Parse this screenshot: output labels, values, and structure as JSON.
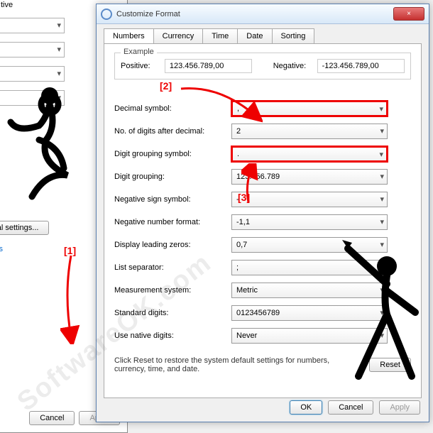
{
  "bg": {
    "tive_label": "tive",
    "additional": "Additional settings...",
    "link": "ional formats",
    "cancel": "Cancel",
    "apply": "Apply"
  },
  "dialog": {
    "title": "Customize Format",
    "close": "×",
    "tabs": [
      "Numbers",
      "Currency",
      "Time",
      "Date",
      "Sorting"
    ],
    "example": {
      "legend": "Example",
      "pos_label": "Positive:",
      "pos_value": "123.456.789,00",
      "neg_label": "Negative:",
      "neg_value": "-123.456.789,00"
    },
    "rows": [
      {
        "label": "Decimal symbol:",
        "value": ",",
        "highlight": true
      },
      {
        "label": "No. of digits after decimal:",
        "value": "2"
      },
      {
        "label": "Digit grouping symbol:",
        "value": ".",
        "highlight": true
      },
      {
        "label": "Digit grouping:",
        "value": "123.456.789"
      },
      {
        "label": "Negative sign symbol:",
        "value": "-"
      },
      {
        "label": "Negative number format:",
        "value": "-1,1"
      },
      {
        "label": "Display leading zeros:",
        "value": "0,7"
      },
      {
        "label": "List separator:",
        "value": ";"
      },
      {
        "label": "Measurement system:",
        "value": "Metric"
      },
      {
        "label": "Standard digits:",
        "value": "0123456789"
      },
      {
        "label": "Use native digits:",
        "value": "Never"
      }
    ],
    "reset_text": "Click Reset to restore the system default settings for numbers, currency, time, and date.",
    "reset": "Reset",
    "ok": "OK",
    "cancel": "Cancel",
    "apply": "Apply"
  },
  "markers": [
    "[1]",
    "[2]",
    "[3]"
  ],
  "watermark": "SoftwareOK.com"
}
